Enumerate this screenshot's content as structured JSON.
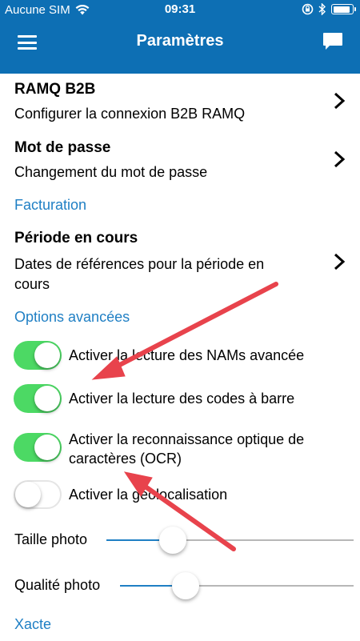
{
  "status": {
    "carrier": "Aucune SIM",
    "time": "09:31",
    "wifi_icon": "wifi-icon",
    "battery_level": 0.9
  },
  "nav": {
    "title": "Paramètres",
    "menu_icon": "hamburger-icon",
    "chat_icon": "chat-icon"
  },
  "settings": {
    "ramq": {
      "title": "RAMQ B2B",
      "subtitle": "Configurer la connexion B2B RAMQ"
    },
    "password": {
      "title": "Mot de passe",
      "subtitle": "Changement du mot de passe"
    },
    "billing_section": "Facturation",
    "period": {
      "title": "Période en cours",
      "subtitle": "Dates de références pour la période en cours"
    },
    "advanced_section": "Options avancées",
    "toggles": [
      {
        "label": "Activer la lecture des NAMs avancée",
        "on": true
      },
      {
        "label": "Activer la lecture des codes à barre",
        "on": true
      },
      {
        "label": "Activer la reconnaissance optique de caractères (OCR)",
        "on": true
      },
      {
        "label": "Activer la géolocalisation",
        "on": false
      }
    ],
    "photo_size": {
      "label": "Taille photo",
      "value": 0.27
    },
    "photo_quality": {
      "label": "Qualité photo",
      "value": 0.28
    },
    "xacte_section": "Xacte"
  },
  "colors": {
    "header": "#0d6fb4",
    "accent": "#1f7fc4",
    "switch_on": "#4cd964",
    "arrow": "#e8434c"
  }
}
